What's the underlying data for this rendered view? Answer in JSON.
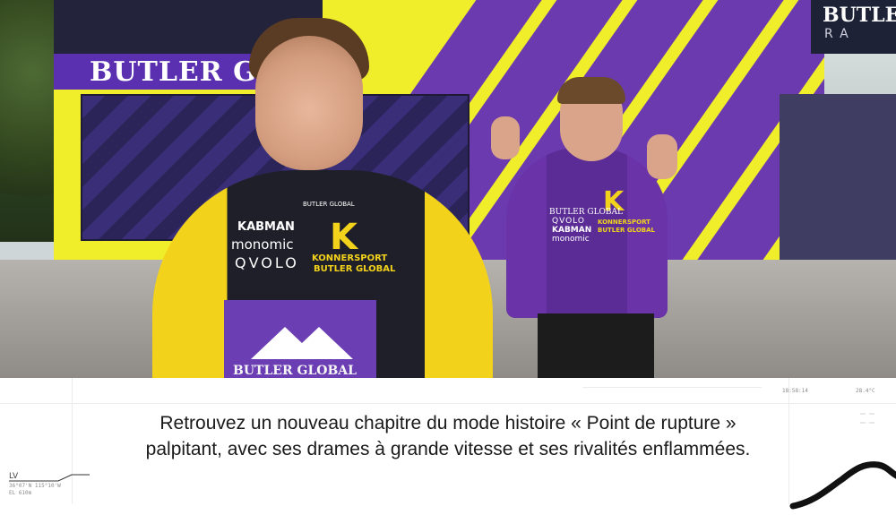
{
  "scene": {
    "banner_text": "BUTLER GLOBAL",
    "banner_visible": "BUTLER GLO",
    "sign_right_text": "BUTLER",
    "sign_right_sub": "RA",
    "woman_suit": {
      "logo_letter": "K",
      "kabman": "KABMAN",
      "monomic": "monomic",
      "qvolo": "QVOLO",
      "konnersport": "KONNERSPORT",
      "butler_global": "BUTLER GLOBAL",
      "collar": "BUTLER GLOBAL",
      "bottom_text": "BUTLER GLOBAL"
    },
    "man_shirt": {
      "logo_letter": "K",
      "butler_global": "BUTLER GLOBAL",
      "qvolo": "QVOLO",
      "kabman": "KABMAN",
      "monomic": "monomic",
      "konnersport": "KONNERSPORT",
      "butler": "BUTLER GLOBAL"
    }
  },
  "subtitle": {
    "line1": "Retrouvez un nouveau chapitre du mode histoire « Point de rupture »",
    "line2": "palpitant, avec ses drames à grande vitesse et ses rivalités enflammées."
  },
  "telemetry": {
    "label": "LV",
    "coordinates": "36°07'N 115°10'W",
    "elevation": "EL 610m",
    "time": "18:58:14",
    "temperature": "28.4°C"
  },
  "colors": {
    "team_yellow": "#f2d21b",
    "team_purple": "#6430b6",
    "caption_text": "#1a1a1a"
  }
}
